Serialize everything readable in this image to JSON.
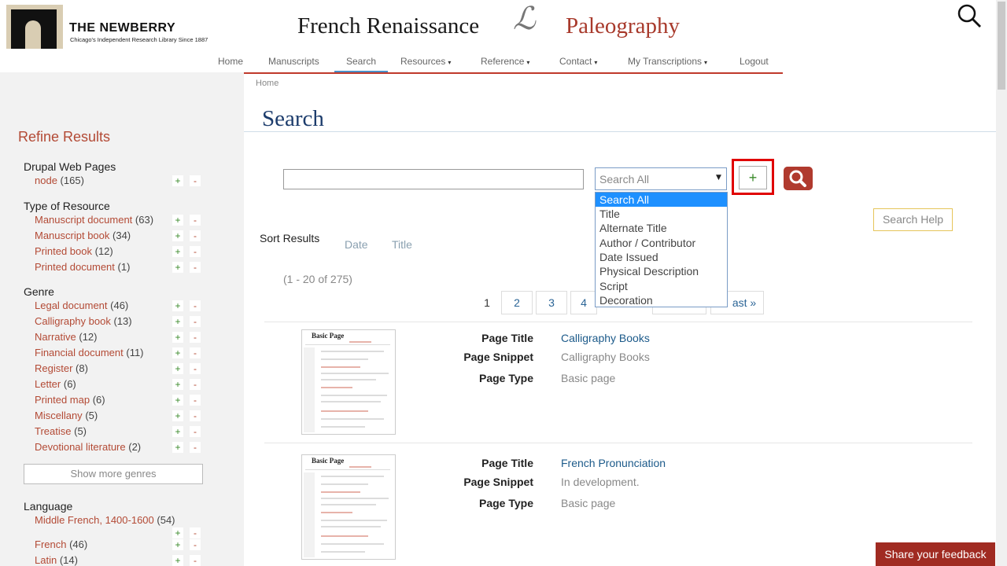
{
  "header": {
    "org_name": "THE NEWBERRY",
    "org_tagline": "Chicago's Independent Research Library Since 1887",
    "site_title_left": "French Renaissance",
    "site_monogram": "ℒ",
    "site_title_right": "Paleography"
  },
  "nav": {
    "items": [
      {
        "label": "Home"
      },
      {
        "label": "Manuscripts"
      },
      {
        "label": "Search"
      },
      {
        "label": "Resources"
      },
      {
        "label": "Reference"
      },
      {
        "label": "Contact"
      },
      {
        "label": "My Transcriptions"
      },
      {
        "label": "Logout"
      }
    ],
    "caret": "▾"
  },
  "breadcrumb": "Home",
  "page_title": "Search",
  "sidebar": {
    "title": "Refine Results",
    "plus": "+",
    "minus": "-",
    "facets": [
      {
        "heading": "Drupal Web Pages",
        "items": [
          {
            "label": "node",
            "count": "(165)"
          }
        ]
      },
      {
        "heading": "Type of Resource",
        "items": [
          {
            "label": "Manuscript document",
            "count": "(63)"
          },
          {
            "label": "Manuscript book",
            "count": "(34)"
          },
          {
            "label": "Printed book",
            "count": "(12)"
          },
          {
            "label": "Printed document",
            "count": "(1)"
          }
        ]
      },
      {
        "heading": "Genre",
        "items": [
          {
            "label": "Legal document",
            "count": "(46)"
          },
          {
            "label": "Calligraphy book",
            "count": "(13)"
          },
          {
            "label": "Narrative",
            "count": "(12)"
          },
          {
            "label": "Financial document",
            "count": "(11)"
          },
          {
            "label": "Register",
            "count": "(8)"
          },
          {
            "label": "Letter",
            "count": "(6)"
          },
          {
            "label": "Printed map",
            "count": "(6)"
          },
          {
            "label": "Miscellany",
            "count": "(5)"
          },
          {
            "label": "Treatise",
            "count": "(5)"
          },
          {
            "label": "Devotional literature",
            "count": "(2)"
          }
        ]
      },
      {
        "heading": "Language",
        "items": [
          {
            "label": "Middle French, 1400-1600",
            "count": "(54)"
          },
          {
            "label": "French",
            "count": "(46)"
          },
          {
            "label": "Latin",
            "count": "(14)"
          }
        ]
      }
    ],
    "show_more": "Show more genres"
  },
  "search": {
    "input_value": "",
    "select_value": "Search All",
    "options": [
      "Search All",
      "Title",
      "Alternate Title",
      "Author / Contributor",
      "Date Issued",
      "Physical Description",
      "Script",
      "Decoration"
    ],
    "add_label": "+",
    "help_label": "Search Help"
  },
  "sort": {
    "label": "Sort Results",
    "options": [
      "Date",
      "Title"
    ]
  },
  "result_count": "(1 - 20 of 275)",
  "pagination": [
    "1",
    "2",
    "3",
    "4",
    "ast »"
  ],
  "results": [
    {
      "thumb_title": "Basic Page",
      "labels": {
        "title": "Page Title",
        "snippet": "Page Snippet",
        "type": "Page Type"
      },
      "title": "Calligraphy Books",
      "snippet": "Calligraphy Books",
      "type": "Basic page"
    },
    {
      "thumb_title": "Basic Page",
      "labels": {
        "title": "Page Title",
        "snippet": "Page Snippet",
        "type": "Page Type"
      },
      "title": "French Pronunciation",
      "snippet": "In development.",
      "type": "Basic page"
    }
  ],
  "feedback_label": "Share your feedback",
  "colors": {
    "brand_red": "#a83a2c",
    "select_highlight": "#1e90ff",
    "title_blue": "#1c3c6c",
    "callout_red": "#e00000"
  }
}
